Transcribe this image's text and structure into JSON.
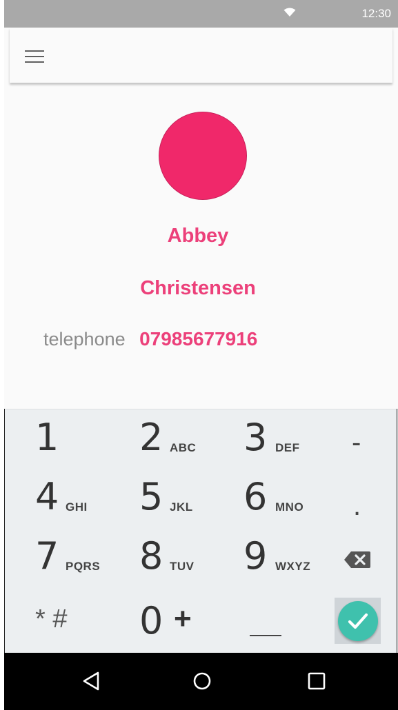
{
  "status_bar": {
    "time": "12:30",
    "wifi_icon": "wifi-icon"
  },
  "app_bar": {
    "menu_icon": "menu-icon"
  },
  "contact": {
    "first_name": "Abbey",
    "last_name": "Christensen",
    "phone_label": "telephone",
    "phone_number": "07985677916",
    "avatar_color": "#f0286a"
  },
  "dialpad": {
    "keys": [
      {
        "digit": "1",
        "letters": ""
      },
      {
        "digit": "2",
        "letters": "ABC"
      },
      {
        "digit": "3",
        "letters": "DEF"
      },
      {
        "digit": "4",
        "letters": "GHI"
      },
      {
        "digit": "5",
        "letters": "JKL"
      },
      {
        "digit": "6",
        "letters": "MNO"
      },
      {
        "digit": "7",
        "letters": "PQRS"
      },
      {
        "digit": "8",
        "letters": "TUV"
      },
      {
        "digit": "9",
        "letters": "WXYZ"
      },
      {
        "digit": "0",
        "letters": "+"
      }
    ],
    "dash": "-",
    "dot": ".",
    "star_hash": "* #",
    "backspace_icon": "backspace-icon",
    "confirm_icon": "check-icon",
    "confirm_color": "#3fc1ad"
  },
  "nav_bar": {
    "back_icon": "back-triangle-icon",
    "home_icon": "home-circle-icon",
    "recents_icon": "recents-square-icon"
  }
}
